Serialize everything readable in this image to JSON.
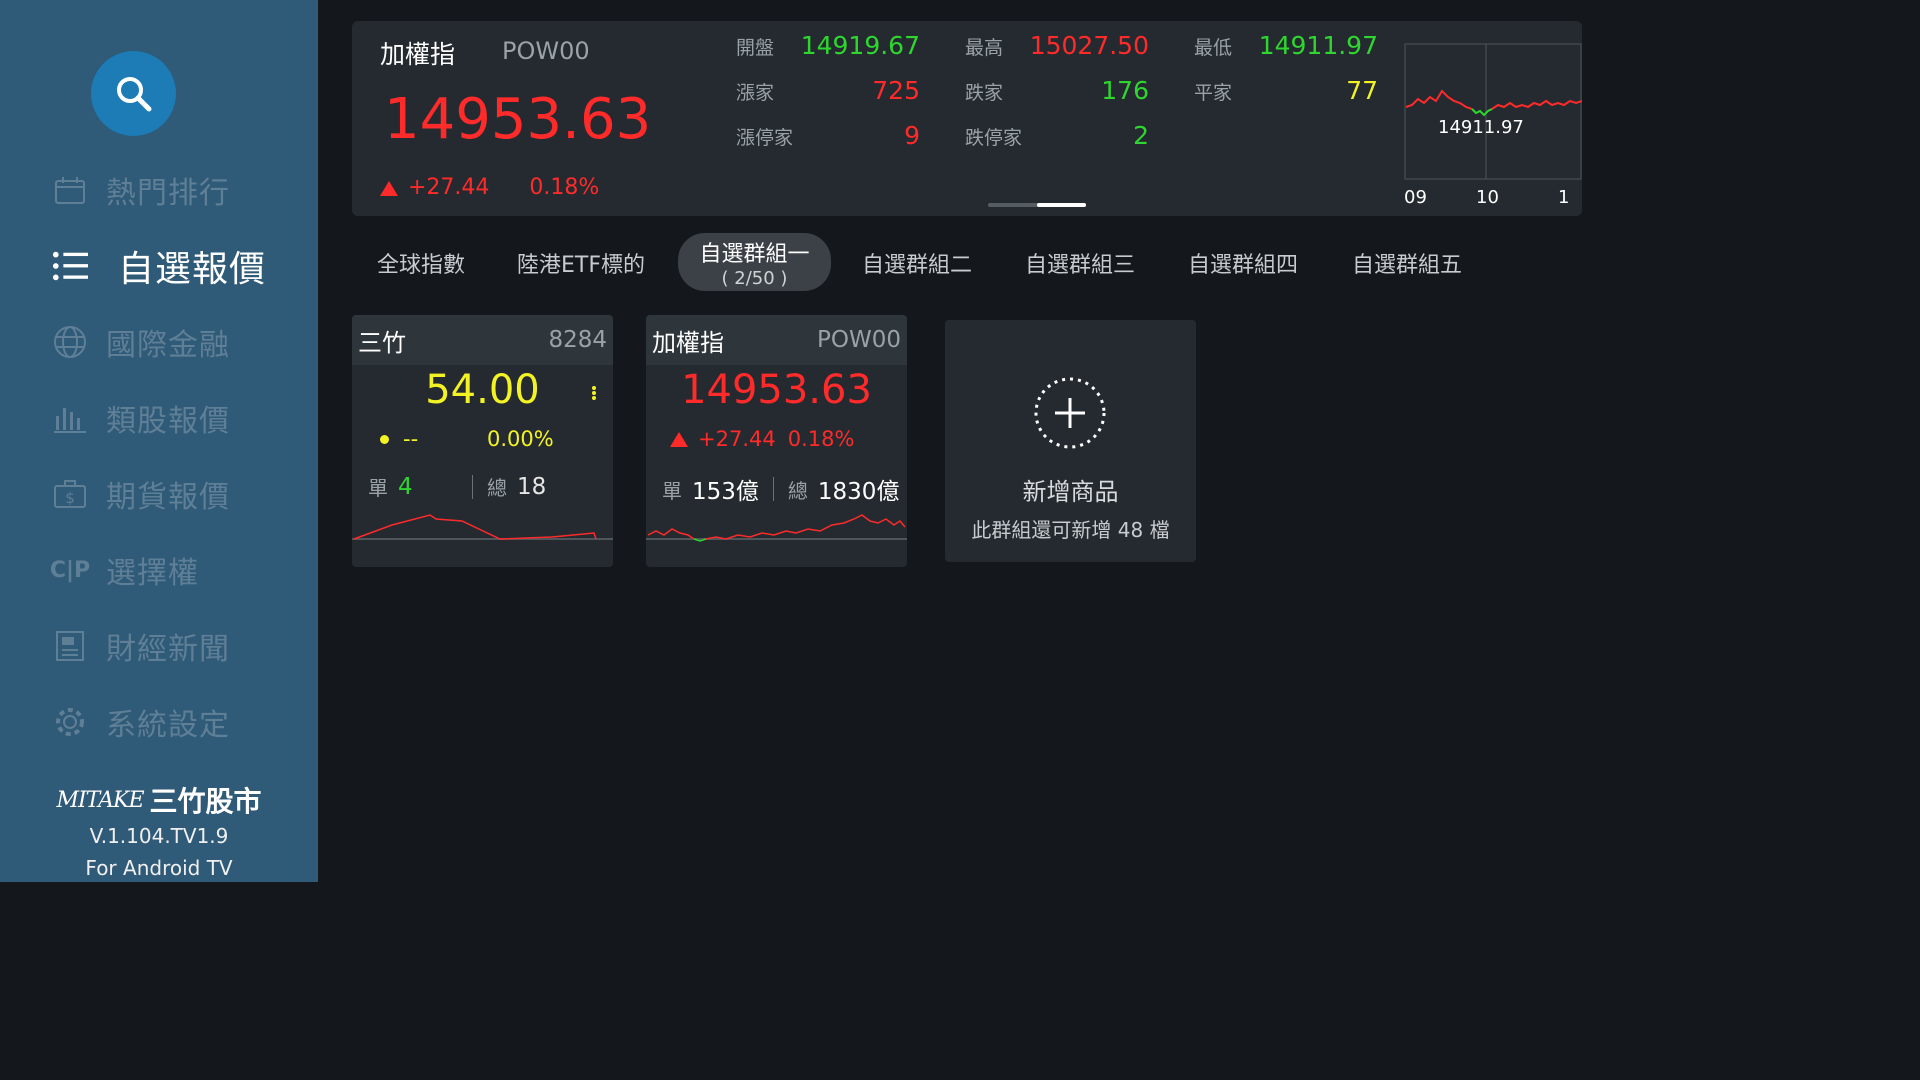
{
  "sidebar": {
    "items": [
      {
        "label": "熱門排行",
        "icon": "calendar-icon"
      },
      {
        "label": "自選報價",
        "icon": "list-icon"
      },
      {
        "label": "國際金融",
        "icon": "globe-icon"
      },
      {
        "label": "類股報價",
        "icon": "bar-chart-icon"
      },
      {
        "label": "期貨報價",
        "icon": "dollar-case-icon"
      },
      {
        "label": "選擇權",
        "icon": "cp-icon",
        "icon_text": "C|P"
      },
      {
        "label": "財經新聞",
        "icon": "newspaper-icon"
      },
      {
        "label": "系統設定",
        "icon": "gear-icon"
      }
    ],
    "active_index": 1,
    "brand": {
      "logo": "MITAKE",
      "name": "三竹股市",
      "version": "V.1.104.TV1.9",
      "platform": "For Android TV"
    }
  },
  "quote": {
    "name": "加權指",
    "code": "POW00",
    "price": "14953.63",
    "change": "+27.44",
    "change_pct": "0.18%",
    "stats": [
      {
        "label": "開盤",
        "value": "14919.67",
        "color": "#2fd62f"
      },
      {
        "label": "最高",
        "value": "15027.50",
        "color": "#ff2a2a"
      },
      {
        "label": "最低",
        "value": "14911.97",
        "color": "#2fd62f"
      },
      {
        "label": "漲家",
        "value": "725",
        "color": "#ff2a2a"
      },
      {
        "label": "跌家",
        "value": "176",
        "color": "#2fd62f"
      },
      {
        "label": "平家",
        "value": "77",
        "color": "#f3f324"
      },
      {
        "label": "漲停家",
        "value": "9",
        "color": "#ff2a2a"
      },
      {
        "label": "跌停家",
        "value": "2",
        "color": "#2fd62f"
      }
    ],
    "mini_chart": {
      "low_label": "14911.97",
      "x_ticks": [
        "09",
        "10",
        "1"
      ]
    }
  },
  "tabs": [
    {
      "label": "全球指數"
    },
    {
      "label": "陸港ETF標的"
    },
    {
      "label": "自選群組一",
      "count": "( 2/50 )"
    },
    {
      "label": "自選群組二"
    },
    {
      "label": "自選群組三"
    },
    {
      "label": "自選群組四"
    },
    {
      "label": "自選群組五"
    }
  ],
  "cards": [
    {
      "name": "三竹",
      "code": "8284",
      "price": "54.00",
      "change": "--",
      "change_pct": "0.00%",
      "single_label": "單",
      "single": "4",
      "total_label": "總",
      "total": "18"
    },
    {
      "name": "加權指",
      "code": "POW00",
      "price": "14953.63",
      "change": "+27.44",
      "change_pct": "0.18%",
      "single_label": "單",
      "single": "153億",
      "total_label": "總",
      "total": "1830億"
    }
  ],
  "add_card": {
    "title": "新增商品",
    "subtitle": "此群組還可新增 48 檔"
  }
}
